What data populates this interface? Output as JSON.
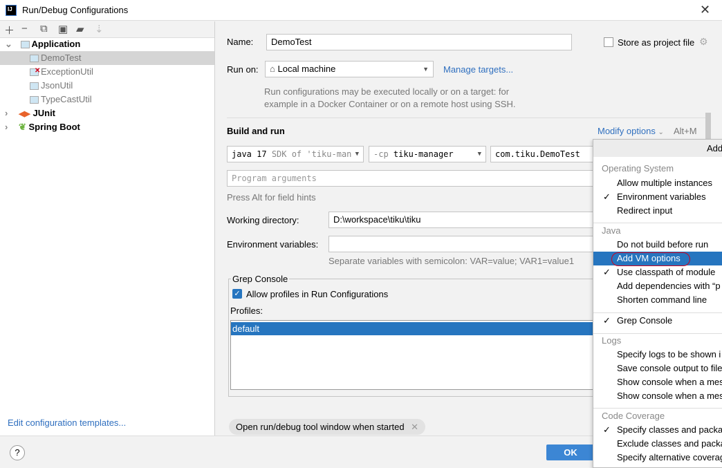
{
  "window": {
    "title": "Run/Debug Configurations",
    "logo": "IJ"
  },
  "toolbar": {
    "icons": [
      "plus-icon",
      "minus-icon",
      "copy-icon",
      "save-icon",
      "folder-add-icon",
      "sort-icon"
    ]
  },
  "tree": {
    "groups": [
      {
        "label": "Application",
        "expanded": true,
        "children": [
          "DemoTest",
          "ExceptionUtil",
          "JsonUtil",
          "TypeCastUtil"
        ]
      },
      {
        "label": "JUnit"
      },
      {
        "label": "Spring Boot"
      }
    ]
  },
  "edit_templates": "Edit configuration templates...",
  "form": {
    "name_label": "Name:",
    "name_value": "DemoTest",
    "store_label": "Store as project file",
    "run_on_label": "Run on:",
    "run_on_value": "Local machine",
    "manage_targets": "Manage targets...",
    "run_on_hint_1": "Run configurations may be executed locally or on a target: for",
    "run_on_hint_2": "example in a Docker Container or on a remote host using SSH.",
    "build_run": "Build and run",
    "modify_options": "Modify options",
    "modify_shortcut": "Alt+M",
    "sdk_main": "java 17",
    "sdk_sub": "SDK of 'tiku-man",
    "cp_prefix": "-cp",
    "cp_value": "tiku-manager",
    "main_class": "com.tiku.DemoTest",
    "program_args_placeholder": "Program arguments",
    "alt_hint": "Press Alt for field hints",
    "workdir_label": "Working directory:",
    "workdir_value": "D:\\workspace\\tiku\\tiku",
    "env_label": "Environment variables:",
    "env_value": "",
    "env_hint": "Separate variables with semicolon: VAR=value; VAR1=value1",
    "grep_title": "Grep Console",
    "grep_allow": "Allow profiles in Run Configurations",
    "profiles_label": "Profiles:",
    "profiles": [
      "default"
    ],
    "open_tool_window_tag": "Open run/debug tool window when started"
  },
  "menu": {
    "header": "Add",
    "sections": [
      {
        "title": "Operating System",
        "items": [
          {
            "label": "Allow multiple instances",
            "checked": false
          },
          {
            "label": "Environment variables",
            "checked": true
          },
          {
            "label": "Redirect input",
            "checked": false
          }
        ]
      },
      {
        "title": "Java",
        "items": [
          {
            "label": "Do not build before run",
            "checked": false
          },
          {
            "label": "Add VM options",
            "checked": false,
            "highlighted": true
          },
          {
            "label": "Use classpath of module",
            "checked": true
          },
          {
            "label": "Add dependencies with “p",
            "checked": false
          },
          {
            "label": "Shorten command line",
            "checked": false
          }
        ]
      },
      {
        "title": "",
        "items": [
          {
            "label": "Grep Console",
            "checked": true
          }
        ]
      },
      {
        "title": "Logs",
        "items": [
          {
            "label": "Specify logs to be shown i",
            "checked": false
          },
          {
            "label": "Save console output to file",
            "checked": false
          },
          {
            "label": "Show console when a mes",
            "checked": false
          },
          {
            "label": "Show console when a mes",
            "checked": false
          }
        ]
      },
      {
        "title": "Code Coverage",
        "items": [
          {
            "label": "Specify classes and packa",
            "checked": true
          },
          {
            "label": "Exclude classes and packa",
            "checked": false
          },
          {
            "label": "Specify alternative coverag",
            "checked": false
          }
        ]
      }
    ]
  },
  "buttons": {
    "ok": "OK",
    "help": "?"
  },
  "colors": {
    "accent": "#2675bf",
    "selection": "#d5d5d5",
    "link": "#2f6fbf",
    "annotation": "#d0021b"
  }
}
